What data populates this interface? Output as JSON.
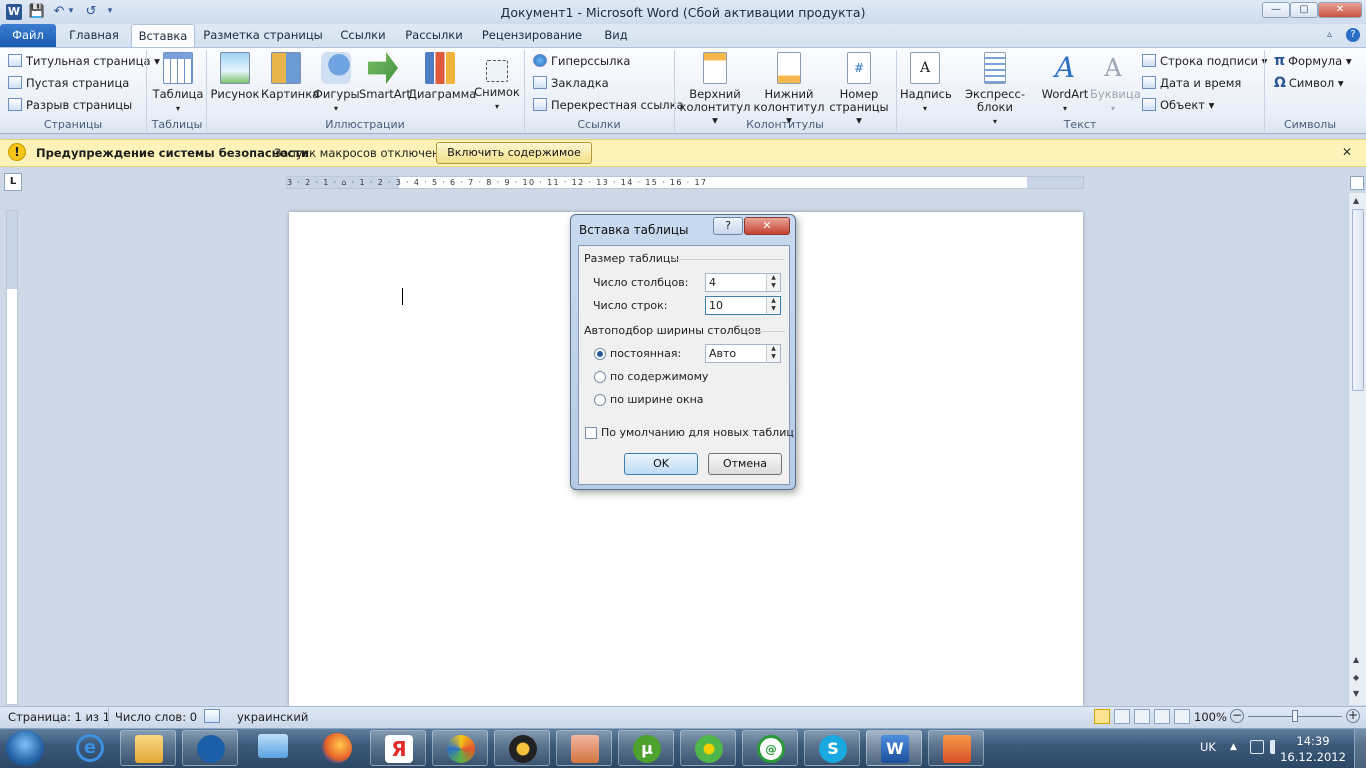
{
  "window": {
    "title": "Документ1  -  Microsoft Word (Сбой активации продукта)"
  },
  "qat": {
    "save": "💾",
    "undo": "↶",
    "redo": "↺",
    "customize": "▾"
  },
  "window_controls": {
    "minimize": "—",
    "maximize": "▢",
    "close": "✕"
  },
  "tabs": {
    "file": "Файл",
    "home": "Главная",
    "insert": "Вставка",
    "layout": "Разметка страницы",
    "references": "Ссылки",
    "mailings": "Рассылки",
    "review": "Рецензирование",
    "view": "Вид"
  },
  "ribbon": {
    "pages": {
      "cover": "Титульная страница",
      "blank": "Пустая страница",
      "break": "Разрыв страницы",
      "group": "Страницы"
    },
    "tables": {
      "table": "Таблица",
      "group": "Таблицы"
    },
    "illustrations": {
      "picture": "Рисунок",
      "clipart": "Картинка",
      "shapes": "Фигуры",
      "smartart": "SmartArt",
      "chart": "Диаграмма",
      "screenshot": "Снимок",
      "group": "Иллюстрации"
    },
    "links": {
      "hyperlink": "Гиперссылка",
      "bookmark": "Закладка",
      "crossref": "Перекрестная ссылка",
      "group": "Ссылки"
    },
    "headerfooter": {
      "header1": "Верхний",
      "header2": "колонтитул",
      "footer1": "Нижний",
      "footer2": "колонтитул",
      "pagenum1": "Номер",
      "pagenum2": "страницы",
      "group": "Колонтитулы"
    },
    "text": {
      "textbox": "Надпись",
      "quickparts": "Экспресс-блоки",
      "wordart": "WordArt",
      "dropcap": "Буквица",
      "signature": "Строка подписи",
      "datetime": "Дата и время",
      "object": "Объект",
      "group": "Текст"
    },
    "symbols": {
      "equation": "Формула",
      "symbol": "Символ",
      "group": "Символы"
    }
  },
  "security_bar": {
    "title": "Предупреждение системы безопасности",
    "message": "Запуск макросов отключен.",
    "button": "Включить содержимое",
    "close": "✕"
  },
  "ruler": {
    "corner": "L",
    "numbers": "3 · 2 · 1 · ⌂ · 1 · 2 · 3 · 4 · 5 · 6 · 7 · 8 · 9 · 10 · 11 · 12 · 13 · 14 · 15 · 16 · 17"
  },
  "dialog": {
    "title": "Вставка таблицы",
    "help": "?",
    "close": "✕",
    "size_section": "Размер таблицы",
    "cols_label": "Число столбцов:",
    "cols_value": "4",
    "rows_label": "Число строк:",
    "rows_value": "10",
    "autofit_section": "Автоподбор ширины столбцов",
    "fixed_label": "постоянная:",
    "fixed_value": "Авто",
    "content_label": "по содержимому",
    "window_label": "по ширине окна",
    "default_label": "По умолчанию для новых таблиц",
    "ok": "OK",
    "cancel": "Отмена"
  },
  "status": {
    "page": "Страница: 1 из 1",
    "words": "Число слов: 0",
    "language": "украинский",
    "zoom": "100%",
    "zoom_level": 1.0
  },
  "taskbar": {
    "lang": "UK",
    "time": "14:39",
    "date": "16.12.2012"
  },
  "colors": {
    "file_tab": "#1b5bb0",
    "security_bar": "#fdf3b8",
    "taskbar": "#3d5a7a"
  }
}
